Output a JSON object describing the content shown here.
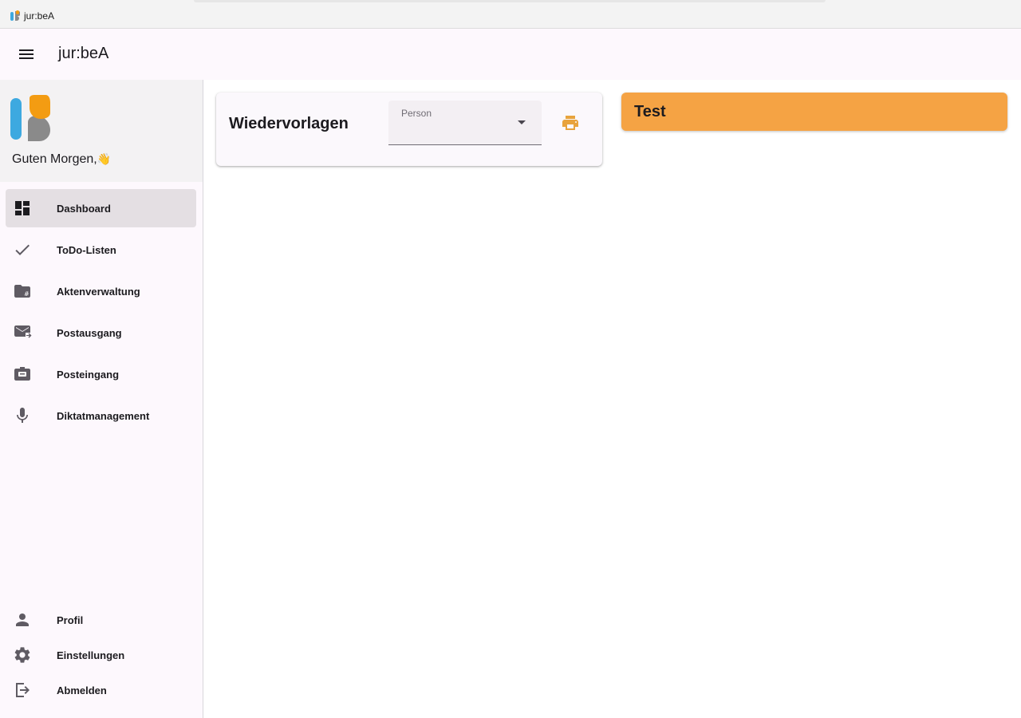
{
  "window": {
    "title": "jur:beA"
  },
  "appbar": {
    "title": "jur:beA",
    "menu_icon": "menu-icon"
  },
  "sidebar": {
    "greeting": "Guten Morgen,",
    "greeting_emoji": "👋",
    "items": [
      {
        "label": "Dashboard",
        "icon": "dashboard-icon",
        "active": true
      },
      {
        "label": "ToDo-Listen",
        "icon": "check-icon",
        "active": false
      },
      {
        "label": "Aktenverwaltung",
        "icon": "folder-hash-icon",
        "active": false
      },
      {
        "label": "Postausgang",
        "icon": "mail-forward-icon",
        "active": false
      },
      {
        "label": "Posteingang",
        "icon": "inbox-icon",
        "active": false
      },
      {
        "label": "Diktatmanagement",
        "icon": "mic-icon",
        "active": false
      }
    ],
    "bottom_items": [
      {
        "label": "Profil",
        "icon": "person-icon"
      },
      {
        "label": "Einstellungen",
        "icon": "gear-icon"
      },
      {
        "label": "Abmelden",
        "icon": "logout-icon"
      }
    ]
  },
  "main": {
    "wiedervorlagen": {
      "title": "Wiedervorlagen",
      "person_select": {
        "label": "Person",
        "value": ""
      },
      "print_icon": "print-icon"
    },
    "test_banner": {
      "title": "Test"
    }
  },
  "colors": {
    "accent_orange": "#f5a344",
    "print_icon": "#e8a33c",
    "active_nav": "#e4dfe3",
    "logo_blue": "#3da9e0",
    "logo_orange": "#f39c12",
    "logo_gray": "#8a8a8a"
  }
}
